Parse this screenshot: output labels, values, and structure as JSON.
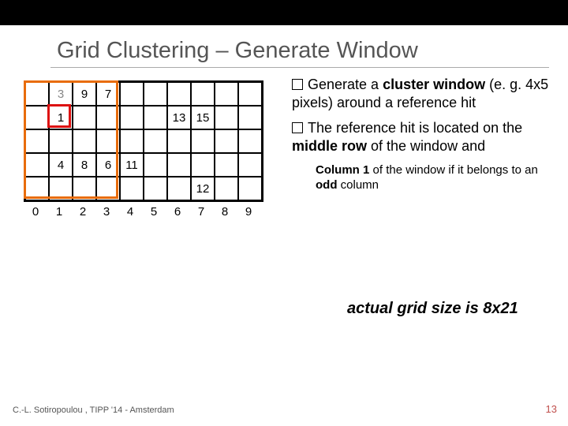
{
  "title": "Grid Clustering – Generate Window",
  "grid": {
    "cols": 10,
    "rows": 5,
    "cells": [
      [
        "",
        "3",
        "9",
        "7",
        "",
        "",
        "",
        "",
        "",
        ""
      ],
      [
        "",
        "1",
        "",
        "",
        "",
        "",
        "13",
        "15",
        "",
        ""
      ],
      [
        "",
        "",
        "",
        "",
        "",
        "",
        "",
        "",
        "",
        ""
      ],
      [
        "",
        "4",
        "8",
        "6",
        "11",
        "",
        "",
        "",
        "",
        ""
      ],
      [
        "",
        "",
        "",
        "",
        "",
        "",
        "",
        "12",
        "",
        ""
      ]
    ],
    "dim_cells": [
      [
        0,
        1
      ]
    ],
    "axis": [
      "0",
      "1",
      "2",
      "3",
      "4",
      "5",
      "6",
      "7",
      "8",
      "9"
    ]
  },
  "overlays": {
    "window_box": true,
    "reference_cell": [
      1,
      1
    ]
  },
  "bullets": [
    {
      "prefix_box": true,
      "html": "Generate a <b>cluster window</b> (e. g. 4x5 pixels) around a reference hit"
    },
    {
      "prefix_box": true,
      "html": "The reference hit is located on the <b>middle row</b> of the window and"
    }
  ],
  "subbullet": "<b>Column 1</b> of the window if it belongs to an <b>odd</b> column",
  "truncated_note": "actual grid size is 8x21",
  "footer": "C.-L. Sotiropoulou , TIPP '14 - Amsterdam",
  "page": "13"
}
